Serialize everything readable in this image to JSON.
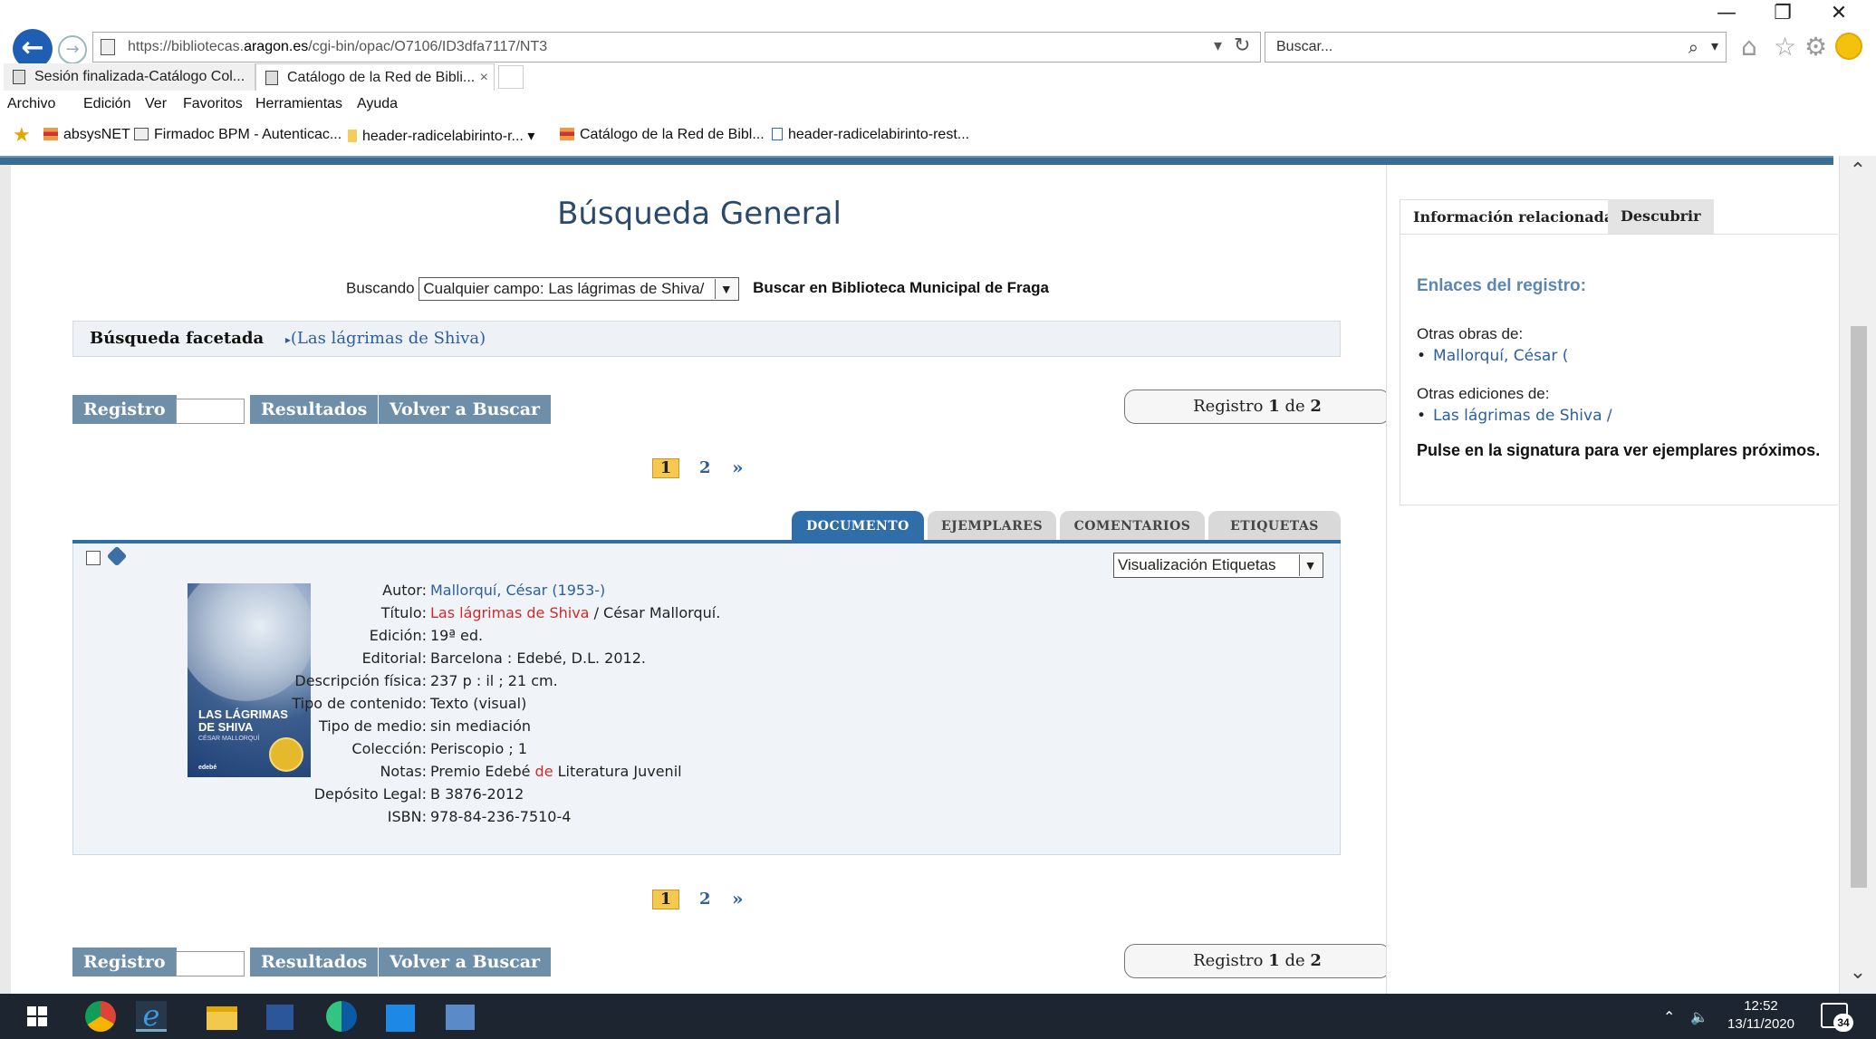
{
  "browser": {
    "url_prefix": "https://biblio",
    "url": "https://bibliotecas.aragon.es/cgi-bin/opac/O7106/ID3dfa7117/NT3",
    "search_placeholder": "Buscar...",
    "tabs": [
      {
        "label": "Sesión finalizada-Catálogo Col...",
        "active": false
      },
      {
        "label": "Catálogo de la Red de Bibli...",
        "active": true
      }
    ],
    "tab_close": "×",
    "menu": [
      "Archivo",
      "Edición",
      "Ver",
      "Favoritos",
      "Herramientas",
      "Ayuda"
    ],
    "favorites": [
      {
        "label": "absysNET",
        "icon": "absysnet-icon"
      },
      {
        "label": "Firmadoc BPM - Autenticac...",
        "icon": "firmadoc-icon"
      },
      {
        "label": "header-radicelabirinto-r...",
        "icon": "folder-icon"
      },
      {
        "label": "Catálogo de la Red de Bibl...",
        "icon": "absysnet-icon"
      },
      {
        "label": "header-radicelabirinto-rest...",
        "icon": "page-icon"
      }
    ],
    "window_buttons": {
      "minimize": "—",
      "restore": "❐",
      "close": "✕"
    }
  },
  "main": {
    "title": "Búsqueda General",
    "search": {
      "prefix": "Buscando",
      "select_value": "Cualquier campo: Las lágrimas de Shiva/",
      "where": "Buscar en Biblioteca Municipal de Fraga"
    },
    "facet": {
      "label": "Búsqueda facetada",
      "link": "(Las lágrimas de Shiva)"
    },
    "buttons": {
      "registro": "Registro",
      "resultados": "Resultados",
      "volver": "Volver a Buscar"
    },
    "record_counter": {
      "prefix": "Registro",
      "current": "1",
      "of": "de",
      "total": "2"
    },
    "pager": {
      "current": "1",
      "next_page": "2",
      "next": "»"
    },
    "record_tabs": [
      {
        "label": "DOCUMENTO",
        "active": true
      },
      {
        "label": "EJEMPLARES",
        "active": false
      },
      {
        "label": "COMENTARIOS",
        "active": false
      },
      {
        "label": "ETIQUETAS",
        "active": false
      }
    ],
    "view_select": "Visualización Etiquetas",
    "cover": {
      "title_line1": "LAS LÁGRIMAS",
      "title_line2": "DE SHIVA",
      "author": "CÉSAR MALLORQUÍ",
      "publisher": "edebé"
    },
    "record": {
      "autor": {
        "label": "Autor:",
        "value": "Mallorquí, César (1953-)"
      },
      "titulo": {
        "label": "Título:",
        "link": "Las lágrimas de Shiva",
        "rest": " / César Mallorquí."
      },
      "edicion": {
        "label": "Edición:",
        "value": "19ª ed."
      },
      "editorial": {
        "label": "Editorial:",
        "value": "Barcelona : Edebé, D.L. 2012."
      },
      "descripcion": {
        "label": "Descripción física:",
        "value": "237 p : il ; 21 cm."
      },
      "contenido": {
        "label": "Tipo de contenido:",
        "value": "Texto (visual)"
      },
      "medio": {
        "label": "Tipo de medio:",
        "value": "sin mediación"
      },
      "coleccion": {
        "label": "Colección:",
        "value": "Periscopio ; 1"
      },
      "notas": {
        "label": "Notas:",
        "pre": "Premio Edebé ",
        "red": "de",
        "post": " Literatura Juvenil"
      },
      "deposito": {
        "label": "Depósito Legal:",
        "value": "B 3876-2012"
      },
      "isbn": {
        "label": "ISBN:",
        "value": "978-84-236-7510-4"
      }
    }
  },
  "side": {
    "tabs": [
      "Información relacionada",
      "Descubrir"
    ],
    "heading": "Enlaces del registro:",
    "otras_obras_label": "Otras obras de:",
    "otras_obras_link": "Mallorquí, César (",
    "otras_ediciones_label": "Otras ediciones de:",
    "otras_ediciones_link": "Las lágrimas de Shiva /",
    "note": "Pulse en la signatura para ver ejemplares próximos."
  },
  "taskbar": {
    "time": "12:52",
    "date": "13/11/2020",
    "notifications": "34"
  }
}
